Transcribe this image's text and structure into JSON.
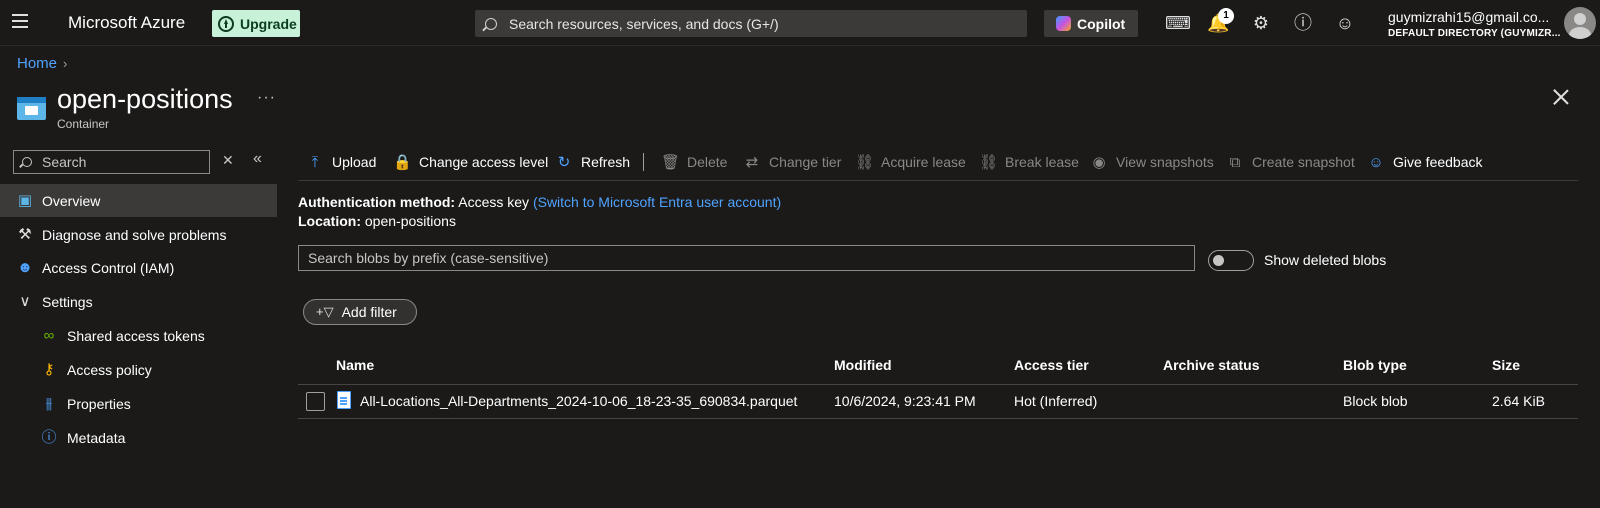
{
  "topbar": {
    "brand": "Microsoft Azure",
    "upgrade_label": "Upgrade",
    "search_placeholder": "Search resources, services, and docs (G+/)",
    "copilot_label": "Copilot",
    "notification_count": "1",
    "user_email": "guymizrahi15@gmail.co...",
    "user_directory": "DEFAULT DIRECTORY (GUYMIZR..."
  },
  "breadcrumb": {
    "home": "Home"
  },
  "header": {
    "title": "open-positions",
    "subtitle": "Container",
    "more": "···"
  },
  "nav": {
    "search_placeholder": "Search",
    "items": [
      {
        "label": "Overview",
        "icon": "container-icon",
        "active": true
      },
      {
        "label": "Diagnose and solve problems",
        "icon": "wrench-icon"
      },
      {
        "label": "Access Control (IAM)",
        "icon": "people-icon"
      },
      {
        "label": "Settings",
        "icon": "chevron-down-icon"
      },
      {
        "label": "Shared access tokens",
        "icon": "link-icon"
      },
      {
        "label": "Access policy",
        "icon": "key-icon"
      },
      {
        "label": "Properties",
        "icon": "sliders-icon"
      },
      {
        "label": "Metadata",
        "icon": "info-icon"
      }
    ]
  },
  "toolbar": {
    "upload": "Upload",
    "change_access": "Change access level",
    "refresh": "Refresh",
    "delete": "Delete",
    "change_tier": "Change tier",
    "acquire_lease": "Acquire lease",
    "break_lease": "Break lease",
    "view_snapshots": "View snapshots",
    "create_snapshot": "Create snapshot",
    "give_feedback": "Give feedback"
  },
  "info": {
    "auth_label": "Authentication method:",
    "auth_value": "Access key",
    "auth_link": "(Switch to Microsoft Entra user account)",
    "location_label": "Location:",
    "location_value": "open-positions"
  },
  "blob_search_placeholder": "Search blobs by prefix (case-sensitive)",
  "show_deleted_label": "Show deleted blobs",
  "add_filter_label": "Add filter",
  "table": {
    "columns": [
      "Name",
      "Modified",
      "Access tier",
      "Archive status",
      "Blob type",
      "Size"
    ],
    "rows": [
      {
        "name": "All-Locations_All-Departments_2024-10-06_18-23-35_690834.parquet",
        "modified": "10/6/2024, 9:23:41 PM",
        "access_tier": "Hot (Inferred)",
        "archive_status": "",
        "blob_type": "Block blob",
        "size": "2.64 KiB"
      }
    ]
  },
  "colors": {
    "accent": "#4fa3ff",
    "upgrade_bg": "#c7f1d9",
    "background": "#1b1a19",
    "active_nav": "#3b3a39"
  }
}
